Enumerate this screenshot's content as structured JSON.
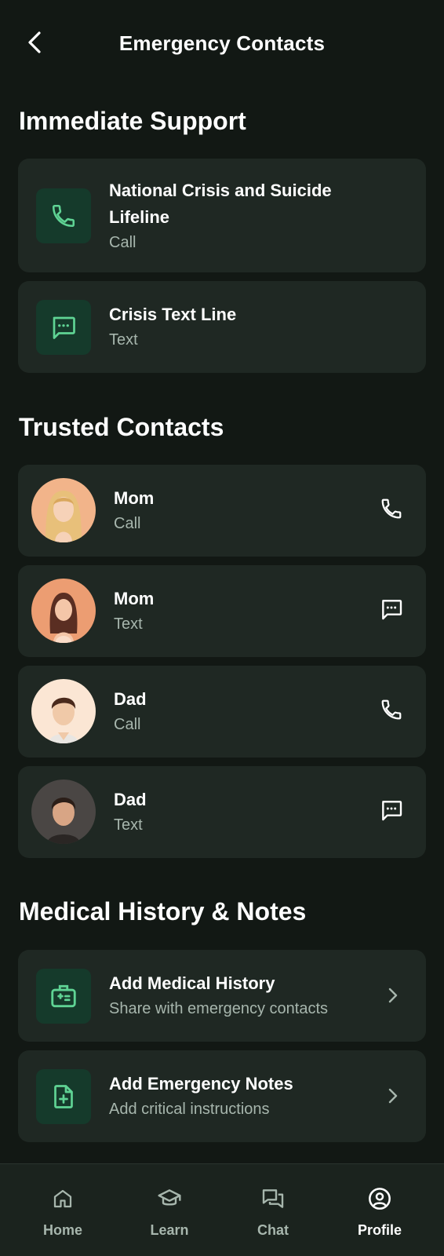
{
  "header": {
    "title": "Emergency Contacts",
    "back_icon": "chevron-left-icon"
  },
  "immediate_support": {
    "title": "Immediate Support",
    "items": [
      {
        "title_line1": "National Crisis and Suicide",
        "title_line2": "Lifeline",
        "subtitle": "Call",
        "icon": "phone-icon"
      },
      {
        "title_line1": "Crisis Text Line",
        "subtitle": "Text",
        "icon": "message-icon"
      }
    ]
  },
  "trusted_contacts": {
    "title": "Trusted Contacts",
    "items": [
      {
        "name": "Mom",
        "subtitle": "Call",
        "action_icon": "phone-icon"
      },
      {
        "name": "Mom",
        "subtitle": "Text",
        "action_icon": "message-icon"
      },
      {
        "name": "Dad",
        "subtitle": "Call",
        "action_icon": "phone-icon"
      },
      {
        "name": "Dad",
        "subtitle": "Text",
        "action_icon": "message-icon"
      }
    ]
  },
  "medical": {
    "title": "Medical History & Notes",
    "items": [
      {
        "title": "Add Medical History",
        "subtitle": "Share with emergency contacts",
        "icon": "medical-kit-icon"
      },
      {
        "title": "Add Emergency Notes",
        "subtitle": "Add critical instructions",
        "icon": "add-document-icon"
      }
    ]
  },
  "bottom_nav": {
    "items": [
      {
        "label": "Home",
        "icon": "home-icon"
      },
      {
        "label": "Learn",
        "icon": "graduation-cap-icon"
      },
      {
        "label": "Chat",
        "icon": "chat-icon"
      },
      {
        "label": "Profile",
        "icon": "user-circle-icon"
      }
    ],
    "active": "Profile"
  },
  "colors": {
    "background": "#121814",
    "card": "#1f2823",
    "accent": "#5fd394",
    "icon_tile": "#153a2b",
    "muted_text": "#a7b6ad"
  }
}
